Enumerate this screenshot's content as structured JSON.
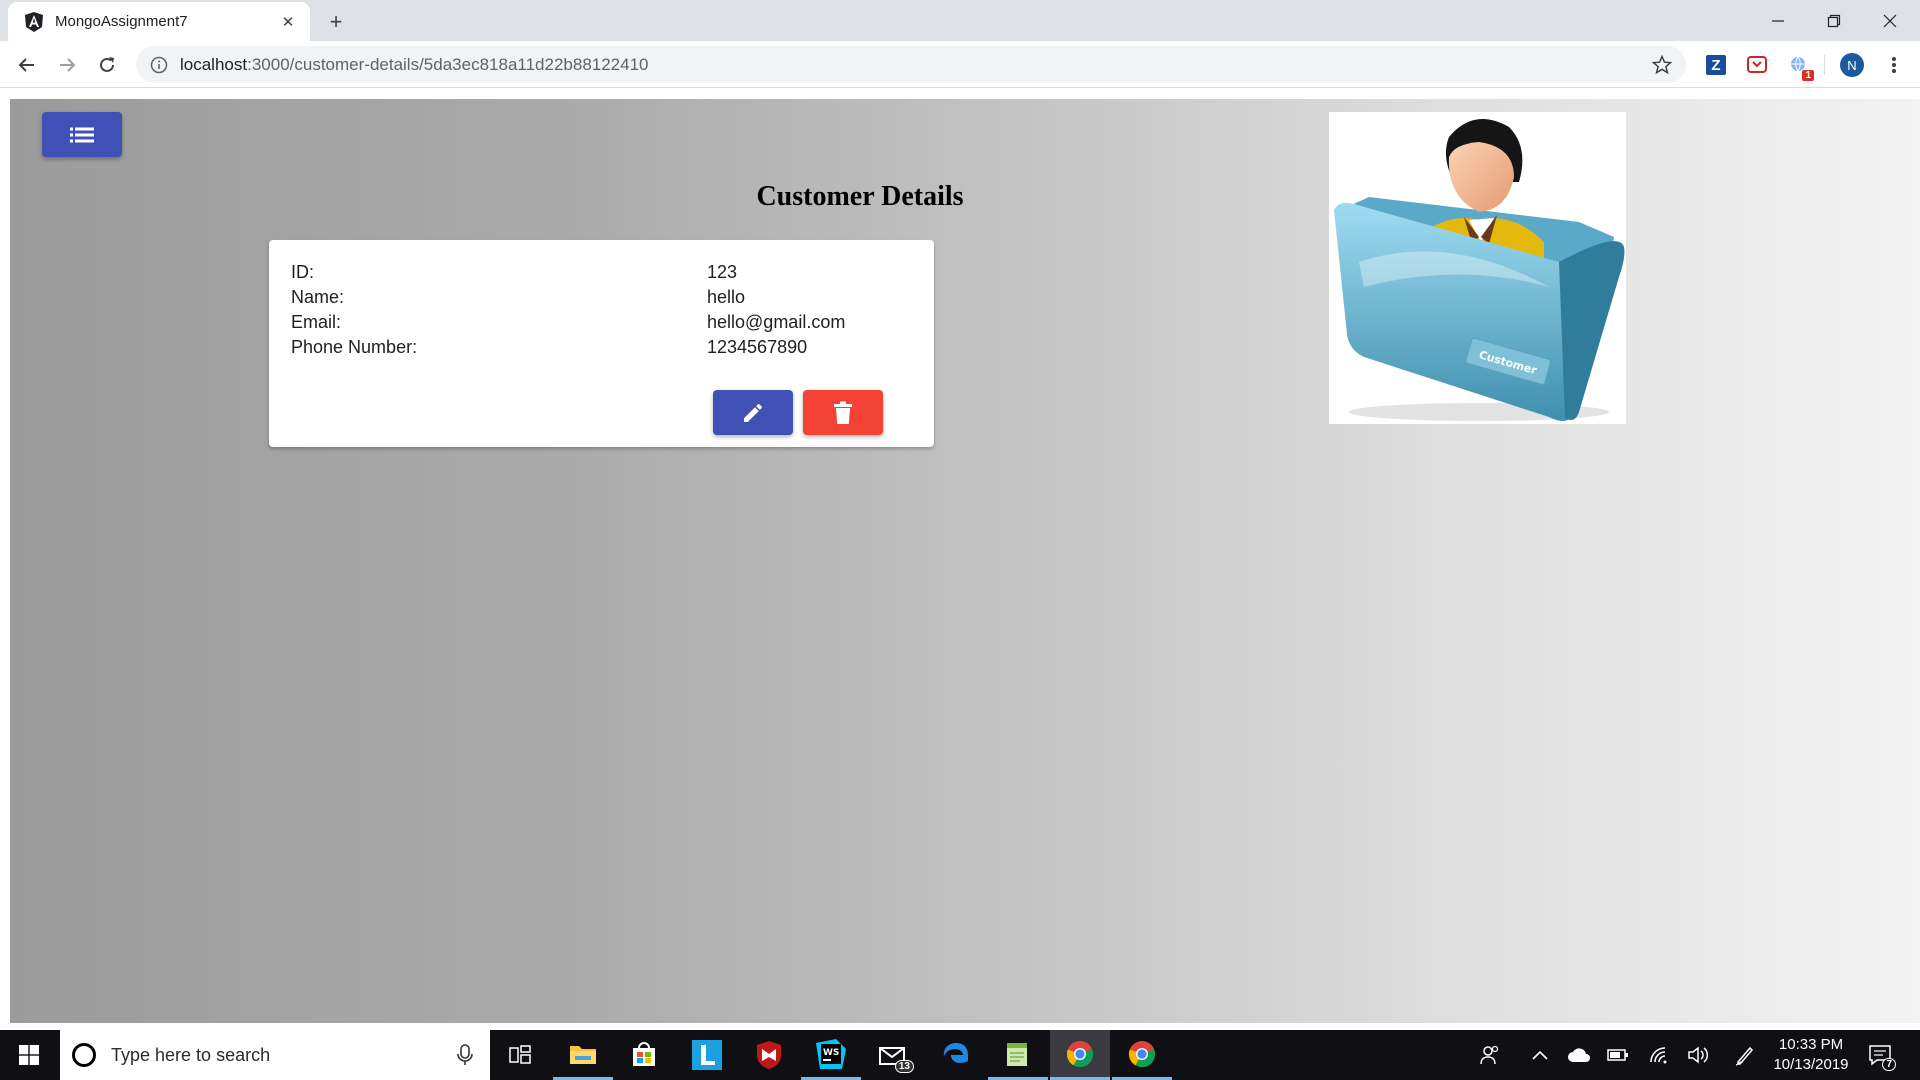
{
  "browser": {
    "tab_title": "MongoAssignment7",
    "url_host": "localhost",
    "url_rest": ":3000/customer-details/5da3ec818a11d22b88122410"
  },
  "extensions": {
    "profile_initial": "N",
    "ext_z_label": "Z",
    "ext_badge": "1"
  },
  "page": {
    "title": "Customer Details",
    "fields": [
      {
        "label": "ID:",
        "value": "123"
      },
      {
        "label": "Name:",
        "value": "hello"
      },
      {
        "label": "Email:",
        "value": "hello@gmail.com"
      },
      {
        "label": "Phone Number:",
        "value": "1234567890"
      }
    ],
    "illustration_text": "Customer",
    "colors": {
      "primary": "#3f51b5",
      "danger": "#f44336"
    }
  },
  "taskbar": {
    "search_placeholder": "Type here to search",
    "time": "10:33 PM",
    "date": "10/13/2019",
    "mail_badge": "13",
    "notification_count": "7",
    "apps": [
      "file-explorer",
      "store",
      "launcher-l",
      "mcafee",
      "webstorm",
      "mail",
      "edge",
      "notepad",
      "chrome",
      "chrome"
    ]
  }
}
